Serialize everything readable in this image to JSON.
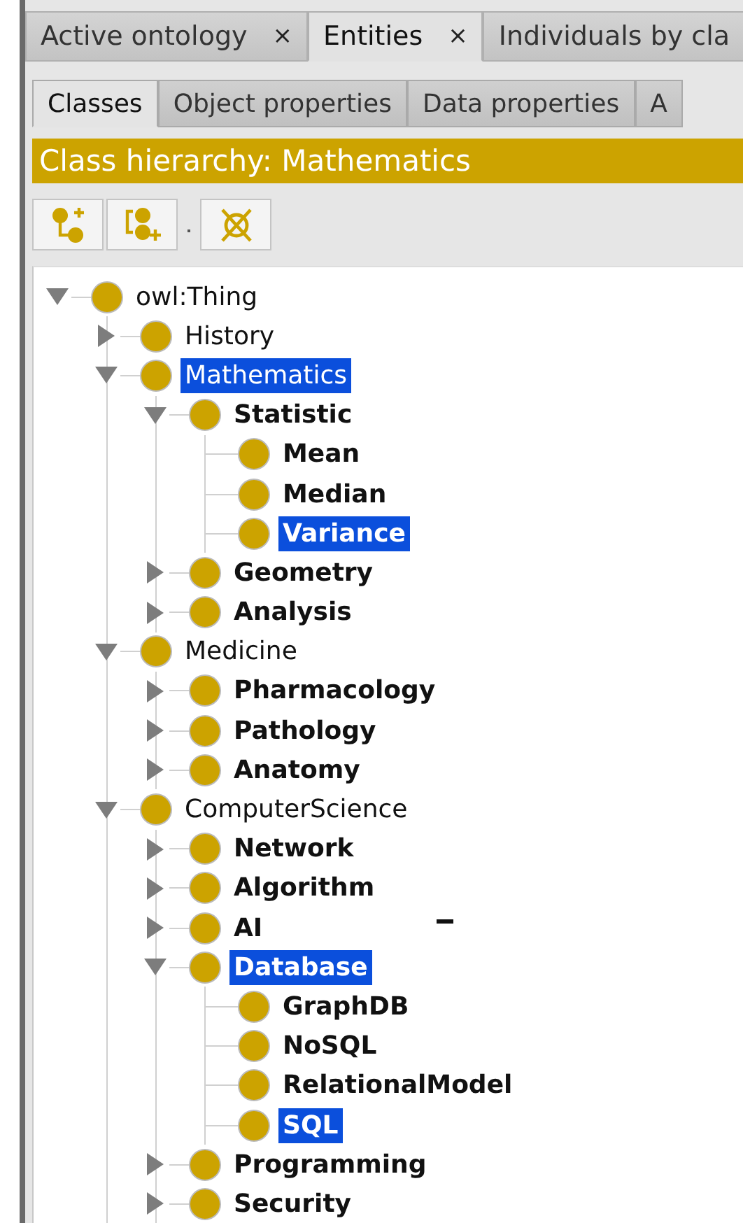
{
  "tabs": [
    {
      "label": "Active ontology",
      "close": "×",
      "selected": false
    },
    {
      "label": "Entities",
      "close": "×",
      "selected": true
    },
    {
      "label": "Individuals by cla",
      "selected": false
    }
  ],
  "subtabs": [
    {
      "label": "Classes",
      "selected": true
    },
    {
      "label": "Object properties",
      "selected": false
    },
    {
      "label": "Data properties",
      "selected": false
    },
    {
      "label": "A",
      "selected": false
    }
  ],
  "view_title": "Class hierarchy: Mathematics",
  "tree": [
    {
      "label": "owl:Thing",
      "kind": "branch",
      "bold": false,
      "selected": false,
      "expanded": true,
      "children": [
        {
          "label": "History",
          "kind": "branch",
          "bold": false,
          "selected": false,
          "expanded": false
        },
        {
          "label": "Mathematics",
          "kind": "branch",
          "bold": false,
          "selected": true,
          "expanded": true,
          "children": [
            {
              "label": "Statistic",
              "kind": "branch",
              "bold": true,
              "selected": false,
              "expanded": true,
              "children": [
                {
                  "label": "Mean",
                  "kind": "leaf",
                  "bold": true,
                  "selected": false
                },
                {
                  "label": "Median",
                  "kind": "leaf",
                  "bold": true,
                  "selected": false
                },
                {
                  "label": "Variance",
                  "kind": "leaf",
                  "bold": true,
                  "selected": true
                }
              ]
            },
            {
              "label": "Geometry",
              "kind": "branch",
              "bold": true,
              "selected": false,
              "expanded": false
            },
            {
              "label": "Analysis",
              "kind": "branch",
              "bold": true,
              "selected": false,
              "expanded": false
            }
          ]
        },
        {
          "label": "Medicine",
          "kind": "branch",
          "bold": false,
          "selected": false,
          "expanded": true,
          "children": [
            {
              "label": "Pharmacology",
              "kind": "branch",
              "bold": true,
              "selected": false,
              "expanded": false
            },
            {
              "label": "Pathology",
              "kind": "branch",
              "bold": true,
              "selected": false,
              "expanded": false
            },
            {
              "label": "Anatomy",
              "kind": "branch",
              "bold": true,
              "selected": false,
              "expanded": false
            }
          ]
        },
        {
          "label": "ComputerScience",
          "kind": "branch",
          "bold": false,
          "selected": false,
          "expanded": true,
          "children": [
            {
              "label": "Network",
              "kind": "branch",
              "bold": true,
              "selected": false,
              "expanded": false
            },
            {
              "label": "Algorithm",
              "kind": "branch",
              "bold": true,
              "selected": false,
              "expanded": false
            },
            {
              "label": "AI",
              "kind": "branch",
              "bold": true,
              "selected": false,
              "expanded": false
            },
            {
              "label": "Database",
              "kind": "branch",
              "bold": true,
              "selected": true,
              "expanded": true,
              "children": [
                {
                  "label": "GraphDB",
                  "kind": "leaf",
                  "bold": true,
                  "selected": false
                },
                {
                  "label": "NoSQL",
                  "kind": "leaf",
                  "bold": true,
                  "selected": false
                },
                {
                  "label": "RelationalModel",
                  "kind": "leaf",
                  "bold": true,
                  "selected": false
                },
                {
                  "label": "SQL",
                  "kind": "leaf",
                  "bold": true,
                  "selected": true
                }
              ]
            },
            {
              "label": "Programming",
              "kind": "branch",
              "bold": true,
              "selected": false,
              "expanded": false
            },
            {
              "label": "Security",
              "kind": "branch",
              "bold": true,
              "selected": false,
              "expanded": false
            }
          ]
        }
      ]
    }
  ]
}
